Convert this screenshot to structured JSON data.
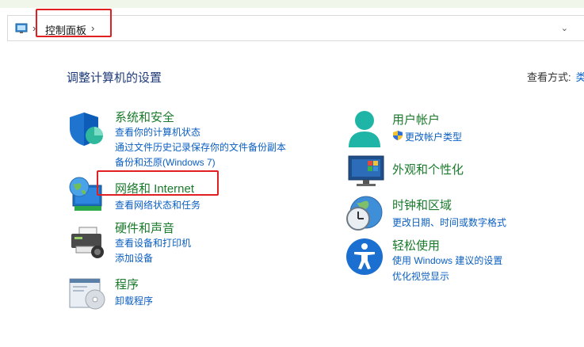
{
  "address": {
    "breadcrumb": "控制面板",
    "separator": "›",
    "dropdown": "⌄"
  },
  "page": {
    "title": "调整计算机的设置",
    "view_by_label": "查看方式:",
    "view_by_value": "类"
  },
  "categories": {
    "system_security": {
      "title": "系统和安全",
      "links": [
        "查看你的计算机状态",
        "通过文件历史记录保存你的文件备份副本",
        "备份和还原(Windows 7)"
      ]
    },
    "network": {
      "title": "网络和 Internet",
      "links": [
        "查看网络状态和任务"
      ]
    },
    "hardware": {
      "title": "硬件和声音",
      "links": [
        "查看设备和打印机",
        "添加设备"
      ]
    },
    "programs": {
      "title": "程序",
      "links": [
        "卸载程序"
      ]
    },
    "user_accounts": {
      "title": "用户帐户",
      "links": [
        "更改帐户类型"
      ]
    },
    "appearance": {
      "title": "外观和个性化",
      "links": []
    },
    "clock_region": {
      "title": "时钟和区域",
      "links": [
        "更改日期、时间或数字格式"
      ]
    },
    "ease_access": {
      "title": "轻松使用",
      "links": [
        "使用 Windows 建议的设置",
        "优化视觉显示"
      ]
    }
  },
  "colors": {
    "link": "#0b5fc0",
    "category_title": "#1a7a2b",
    "highlight_box": "#e02020",
    "title": "#1e3a78"
  }
}
